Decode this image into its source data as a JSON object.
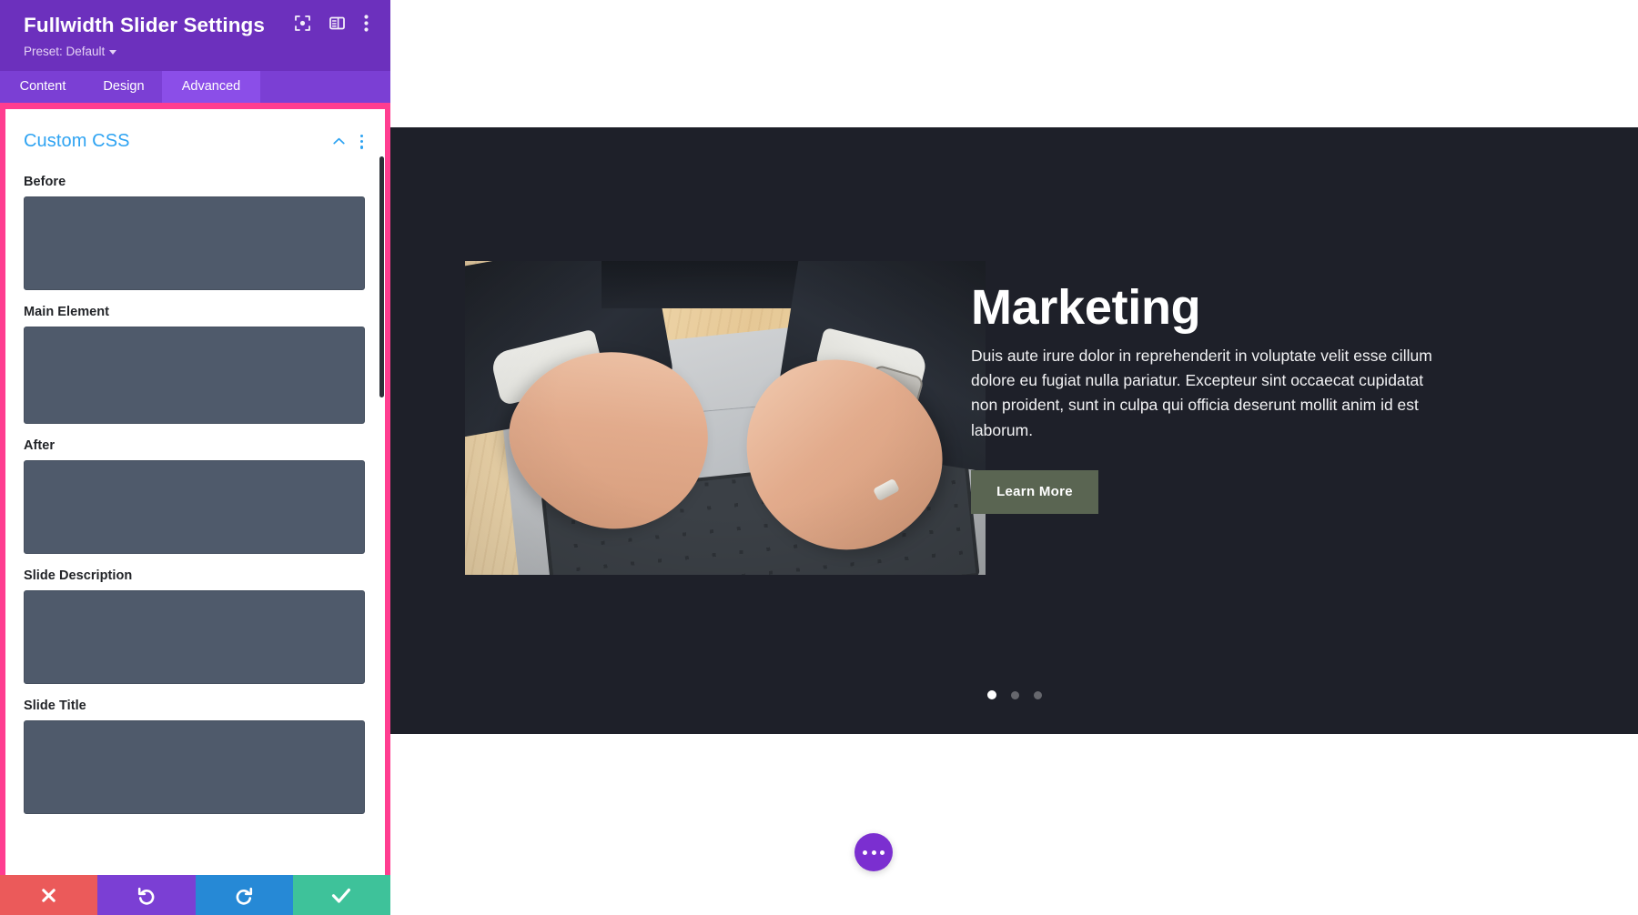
{
  "settings_panel": {
    "header": {
      "title": "Fullwidth Slider Settings",
      "preset_label": "Preset: Default",
      "icons": [
        "focus-target-icon",
        "panel-layout-icon",
        "vertical-dots-icon"
      ]
    },
    "tabs": [
      {
        "label": "Content",
        "active": false
      },
      {
        "label": "Design",
        "active": false
      },
      {
        "label": "Advanced",
        "active": true
      }
    ],
    "section": {
      "title": "Custom CSS",
      "collapse_icon": "chevron-up-icon",
      "menu_icon": "vertical-dots-icon"
    },
    "fields": [
      {
        "label": "Before",
        "value": "",
        "placeholder": ""
      },
      {
        "label": "Main Element",
        "value": "",
        "placeholder": ""
      },
      {
        "label": "After",
        "value": "",
        "placeholder": ""
      },
      {
        "label": "Slide Description",
        "value": "",
        "placeholder": ""
      },
      {
        "label": "Slide Title",
        "value": "",
        "placeholder": ""
      }
    ],
    "actions": [
      {
        "name": "cancel",
        "icon": "close-x-icon",
        "color": "#eb5a5a"
      },
      {
        "name": "undo",
        "icon": "undo-arrow-icon",
        "color": "#7b3fd4"
      },
      {
        "name": "redo",
        "icon": "redo-arrow-icon",
        "color": "#2689d6"
      },
      {
        "name": "save",
        "icon": "checkmark-icon",
        "color": "#3ec29a"
      }
    ],
    "colors": {
      "header_purple": "#6c30bd",
      "tab_purple": "#7b3fd4",
      "tab_active_purple": "#8b4ee8",
      "highlight_pink": "#ff3d90",
      "section_title_blue": "#2ea3f2",
      "textarea_slate": "#4f5a6b"
    }
  },
  "preview": {
    "slide": {
      "heading": "Marketing",
      "description": "Duis aute irure dolor in reprehenderit in voluptate velit esse cillum dolore eu fugiat nulla pariatur. Excepteur sint occaecat cupidatat non proident, sunt in culpa qui officia deserunt mollit anim id est laborum.",
      "button_label": "Learn More",
      "image_alt": "hands typing on a laptop on a wooden desk",
      "dots": [
        {
          "active": true
        },
        {
          "active": false
        },
        {
          "active": false
        }
      ]
    },
    "fab": {
      "icon": "three-dots-icon",
      "color": "#7b2fd0"
    },
    "colors": {
      "stage_dark": "#1e2029",
      "button_olive": "#5a6552"
    }
  }
}
